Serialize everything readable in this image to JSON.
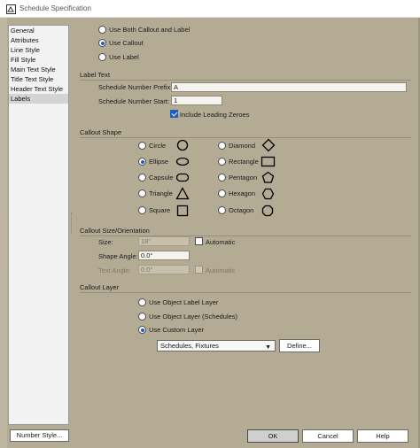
{
  "window": {
    "title": "Schedule Specification"
  },
  "nav": {
    "items": [
      {
        "label": "General"
      },
      {
        "label": "Attributes"
      },
      {
        "label": "Line Style"
      },
      {
        "label": "Fill Style"
      },
      {
        "label": "Main Text Style"
      },
      {
        "label": "Title Text Style"
      },
      {
        "label": "Header Text Style"
      },
      {
        "label": "Labels",
        "selected": true
      }
    ]
  },
  "mode": {
    "options": [
      {
        "label": "Use Both Callout and Label",
        "checked": false
      },
      {
        "label": "Use Callout",
        "checked": true
      },
      {
        "label": "Use Label",
        "checked": false
      }
    ]
  },
  "label_text": {
    "title": "Label Text",
    "prefix_label": "Schedule Number Prefix:",
    "prefix_value": "A",
    "start_label": "Schedule Number Start:",
    "start_value": "1",
    "leading_zeroes_label": "Include Leading Zeroes",
    "leading_zeroes_checked": true
  },
  "callout_shape": {
    "title": "Callout Shape",
    "left": [
      {
        "label": "Circle",
        "icon": "circle-icon",
        "checked": false
      },
      {
        "label": "Ellipse",
        "icon": "ellipse-icon",
        "checked": true
      },
      {
        "label": "Capsule",
        "icon": "capsule-icon",
        "checked": false
      },
      {
        "label": "Triangle",
        "icon": "triangle-icon",
        "checked": false
      },
      {
        "label": "Square",
        "icon": "square-icon",
        "checked": false
      }
    ],
    "right": [
      {
        "label": "Diamond",
        "icon": "diamond-icon",
        "checked": false
      },
      {
        "label": "Rectangle",
        "icon": "rectangle-icon",
        "checked": false
      },
      {
        "label": "Pentagon",
        "icon": "pentagon-icon",
        "checked": false
      },
      {
        "label": "Hexagon",
        "icon": "hexagon-icon",
        "checked": false
      },
      {
        "label": "Octagon",
        "icon": "octagon-icon",
        "checked": false
      }
    ]
  },
  "callout_size": {
    "title": "Callout Size/Orientation",
    "size_label": "Size:",
    "size_value": "18\"",
    "automatic_label": "Automatic",
    "automatic_checked": false,
    "shape_angle_label": "Shape Angle:",
    "shape_angle_value": "0.0°",
    "text_angle_label": "Text Angle:",
    "text_angle_value": "0.0°",
    "text_automatic_label": "Automatic",
    "text_automatic_checked": false
  },
  "callout_layer": {
    "title": "Callout Layer",
    "options": [
      {
        "label": "Use Object Label Layer",
        "checked": false
      },
      {
        "label": "Use Object Layer (Schedules)",
        "checked": false
      },
      {
        "label": "Use Custom Layer",
        "checked": true
      }
    ],
    "layer_select_value": "Schedules, Fixtures",
    "define_label": "Define..."
  },
  "footer": {
    "number_style_label": "Number Style...",
    "ok_label": "OK",
    "cancel_label": "Cancel",
    "help_label": "Help"
  },
  "colors": {
    "accent": "#1a5fc2",
    "dialog_bg": "#b3ab93"
  }
}
